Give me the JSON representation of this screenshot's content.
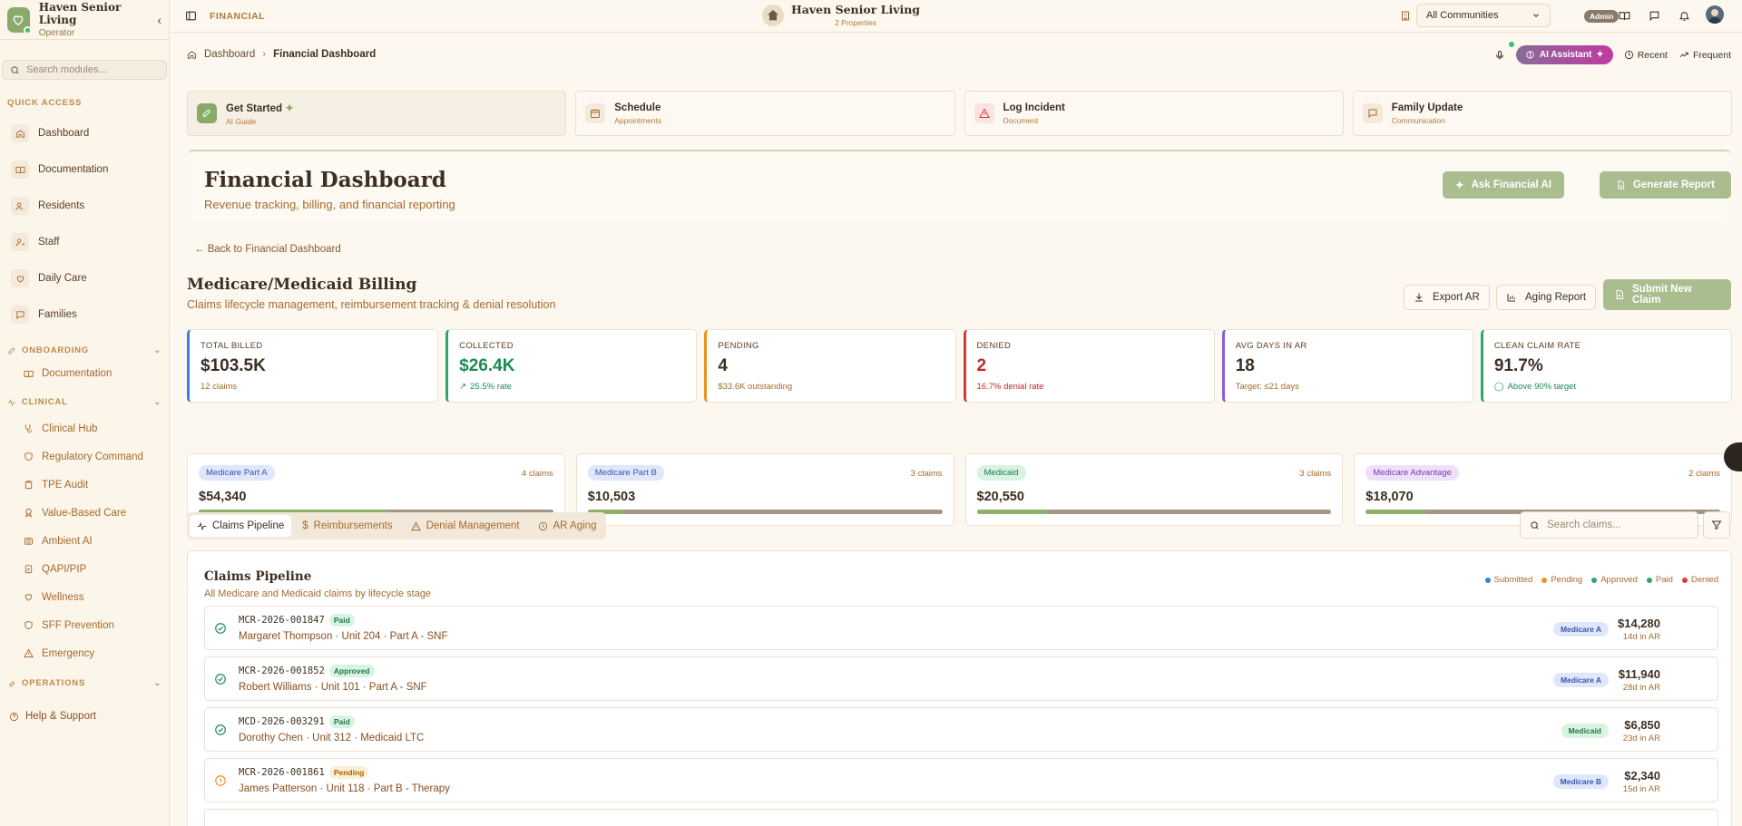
{
  "sidebar": {
    "brand_title": "Haven Senior Living",
    "brand_role": "Operator",
    "search_placeholder": "Search modules...",
    "quick_access_label": "QUICK ACCESS",
    "quick_items": [
      {
        "label": "Dashboard",
        "icon": "home-icon"
      },
      {
        "label": "Documentation",
        "icon": "book-icon"
      },
      {
        "label": "Residents",
        "icon": "users-icon"
      },
      {
        "label": "Staff",
        "icon": "user-check-icon"
      },
      {
        "label": "Daily Care",
        "icon": "heart-icon"
      },
      {
        "label": "Families",
        "icon": "message-icon"
      }
    ],
    "onboarding_label": "ONBOARDING",
    "onboarding_items": [
      {
        "label": "Documentation"
      }
    ],
    "clinical_label": "CLINICAL",
    "clinical_items": [
      {
        "label": "Clinical Hub"
      },
      {
        "label": "Regulatory Command"
      },
      {
        "label": "TPE Audit"
      },
      {
        "label": "Value-Based Care"
      },
      {
        "label": "Ambient AI"
      },
      {
        "label": "QAPI/PIP"
      },
      {
        "label": "Wellness"
      },
      {
        "label": "SFF Prevention"
      },
      {
        "label": "Emergency"
      }
    ],
    "operations_label": "OPERATIONS",
    "help_label": "Help & Support"
  },
  "topbar": {
    "section": "FINANCIAL",
    "center_title": "Haven Senior Living",
    "center_sub": "2 Properties",
    "community_select": "All Communities",
    "admin_badge": "Admin"
  },
  "breadcrumb": {
    "home": "Dashboard",
    "current": "Financial Dashboard"
  },
  "top_actions": {
    "ai": "AI Assistant",
    "recent": "Recent",
    "frequent": "Frequent"
  },
  "quick_actions": [
    {
      "title": "Get Started",
      "sub": "AI Guide"
    },
    {
      "title": "Schedule",
      "sub": "Appointments"
    },
    {
      "title": "Log Incident",
      "sub": "Document"
    },
    {
      "title": "Family Update",
      "sub": "Communication"
    }
  ],
  "header": {
    "title": "Financial Dashboard",
    "subtitle": "Revenue tracking, billing, and financial reporting",
    "ask_ai": "Ask Financial AI",
    "generate": "Generate Report"
  },
  "back_link": "← Back to Financial Dashboard",
  "section": {
    "title": "Medicare/Medicaid Billing",
    "subtitle": "Claims lifecycle management, reimbursement tracking & denial resolution",
    "export": "Export AR",
    "aging": "Aging Report",
    "submit": "Submit New Claim"
  },
  "kpis": [
    {
      "label": "TOTAL BILLED",
      "value": "$103.5K",
      "note": "12 claims",
      "color": "#3b7de0"
    },
    {
      "label": "COLLECTED",
      "value": "$26.4K",
      "note": "25.5% rate",
      "color": "#2ea86a"
    },
    {
      "label": "PENDING",
      "value": "4",
      "note": "$33.6K outstanding",
      "color": "#e8951e"
    },
    {
      "label": "DENIED",
      "value": "2",
      "note": "16.7% denial rate",
      "color": "#d83b3b"
    },
    {
      "label": "AVG DAYS IN AR",
      "value": "18",
      "note": "Target: ≤21 days",
      "color": "#8a5ad8"
    },
    {
      "label": "CLEAN CLAIM RATE",
      "value": "91.7%",
      "note": "Above 90% target",
      "color": "#2ea86a"
    }
  ],
  "payers": [
    {
      "name": "Medicare Part A",
      "claims": "4 claims",
      "amount": "$54,340",
      "fill": 0.53,
      "pill_bg": "#dfe7fb",
      "pill_fg": "#3a56b0"
    },
    {
      "name": "Medicare Part B",
      "claims": "3 claims",
      "amount": "$10,503",
      "fill": 0.1,
      "pill_bg": "#dfe7fb",
      "pill_fg": "#3a56b0"
    },
    {
      "name": "Medicaid",
      "claims": "3 claims",
      "amount": "$20,550",
      "fill": 0.2,
      "pill_bg": "#d9f3e3",
      "pill_fg": "#1e7a4a"
    },
    {
      "name": "Medicare Advantage",
      "claims": "2 claims",
      "amount": "$18,070",
      "fill": 0.17,
      "pill_bg": "#eee0f9",
      "pill_fg": "#7a3ab0"
    }
  ],
  "tabs": [
    {
      "label": "Claims Pipeline",
      "icon": "activity-icon"
    },
    {
      "label": "Reimbursements",
      "icon": "dollar-icon"
    },
    {
      "label": "Denial Management",
      "icon": "alert-triangle-icon"
    },
    {
      "label": "AR Aging",
      "icon": "clock-icon"
    }
  ],
  "claim_search_placeholder": "Search claims...",
  "pipeline": {
    "title": "Claims Pipeline",
    "subtitle": "All Medicare and Medicaid claims by lifecycle stage",
    "legend": [
      {
        "label": "Submitted",
        "color": "#3b7de0"
      },
      {
        "label": "Pending",
        "color": "#e8951e"
      },
      {
        "label": "Approved",
        "color": "#2ea86a"
      },
      {
        "label": "Paid",
        "color": "#2ea86a"
      },
      {
        "label": "Denied",
        "color": "#d83b3b"
      }
    ],
    "claims": [
      {
        "id": "MCR-2026-001847",
        "status": "Paid",
        "who": "Margaret Thompson · Unit 204 · Part A - SNF",
        "payer": "Medicare A",
        "amount": "$14,280",
        "days": "14d in AR"
      },
      {
        "id": "MCR-2026-001852",
        "status": "Approved",
        "who": "Robert Williams · Unit 101 · Part A - SNF",
        "payer": "Medicare A",
        "amount": "$11,940",
        "days": "28d in AR"
      },
      {
        "id": "MCD-2026-003291",
        "status": "Paid",
        "who": "Dorothy Chen · Unit 312 · Medicaid LTC",
        "payer": "Medicaid",
        "amount": "$6,850",
        "days": "23d in AR"
      },
      {
        "id": "MCR-2026-001861",
        "status": "Pending",
        "who": "James Patterson · Unit 118 · Part B - Therapy",
        "payer": "Medicare B",
        "amount": "$2,340",
        "days": "15d in AR"
      }
    ]
  }
}
